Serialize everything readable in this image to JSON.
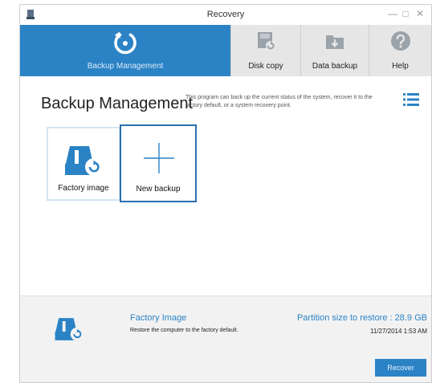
{
  "window": {
    "title": "Recovery"
  },
  "controls": {
    "minimize": "—",
    "maximize": "□",
    "close": "✕"
  },
  "tabs": [
    {
      "label": "Backup Management",
      "icon": "restore-icon"
    },
    {
      "label": "Disk copy",
      "icon": "disk-copy-icon"
    },
    {
      "label": "Data backup",
      "icon": "data-backup-icon"
    },
    {
      "label": "Help",
      "icon": "help-icon"
    }
  ],
  "main": {
    "title": "Backup Management",
    "description": "This program can back up the current status of the system, recover it to the factory default, or a system recovery point."
  },
  "tiles": [
    {
      "label": "Factory image",
      "icon": "factory-image-icon"
    },
    {
      "label": "New backup",
      "icon": "plus-icon"
    }
  ],
  "details": {
    "name": "Factory Image",
    "description": "Restore the computer to the factory default.",
    "partition_size": "Partition size to restore : 28.9 GB",
    "date": "11/27/2014 1:53 AM",
    "recover_label": "Recover"
  },
  "colors": {
    "accent": "#2b83c6",
    "tab_bg": "#e6e6e6",
    "panel_bg": "#f2f2f2"
  }
}
